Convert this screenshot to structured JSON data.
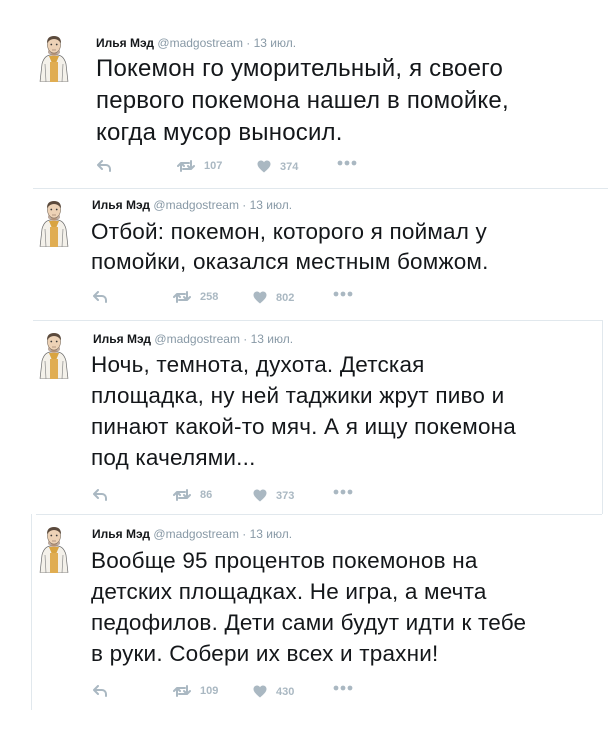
{
  "tweets": [
    {
      "name": "Илья Мэд",
      "handle": "@madgostream",
      "sep": "·",
      "date": "13 июл.",
      "text": "Покемон го уморительный, я своего\nпервого покемона нашел в помойке,\nкогда мусор выносил.",
      "retweets": "107",
      "likes": "374"
    },
    {
      "name": "Илья Мэд",
      "handle": "@madgostream",
      "sep": "·",
      "date": "13 июл.",
      "text": "Отбой: покемон, которого я поймал у\nпомойки, оказался местным бомжом.",
      "retweets": "258",
      "likes": "802"
    },
    {
      "name": "Илья Мэд",
      "handle": "@madgostream",
      "sep": "·",
      "date": "13 июл.",
      "text": "Ночь, темнота, духота. Детская\nплощадка, ну ней таджики жрут пиво и\nпинают какой-то мяч. А я ищу покемона\nпод качелями...",
      "retweets": "86",
      "likes": "373"
    },
    {
      "name": "Илья Мэд",
      "handle": "@madgostream",
      "sep": "·",
      "date": "13 июл.",
      "text": "Вообще 95 процентов покемонов на\nдетских площадках. Не игра, а мечта\nпедофилов. Дети сами будут идти к тебе\nв руки. Собери их всех и трахни!",
      "retweets": "109",
      "likes": "430"
    }
  ],
  "icons": {
    "reply": "reply-arrow",
    "retweet": "retweet-arrows",
    "like": "heart",
    "more": "ellipsis"
  },
  "colors": {
    "action_gray": "#aab8c2",
    "handle_gray": "#8899a6",
    "text": "#14171a",
    "divider": "#e1e8ed"
  }
}
